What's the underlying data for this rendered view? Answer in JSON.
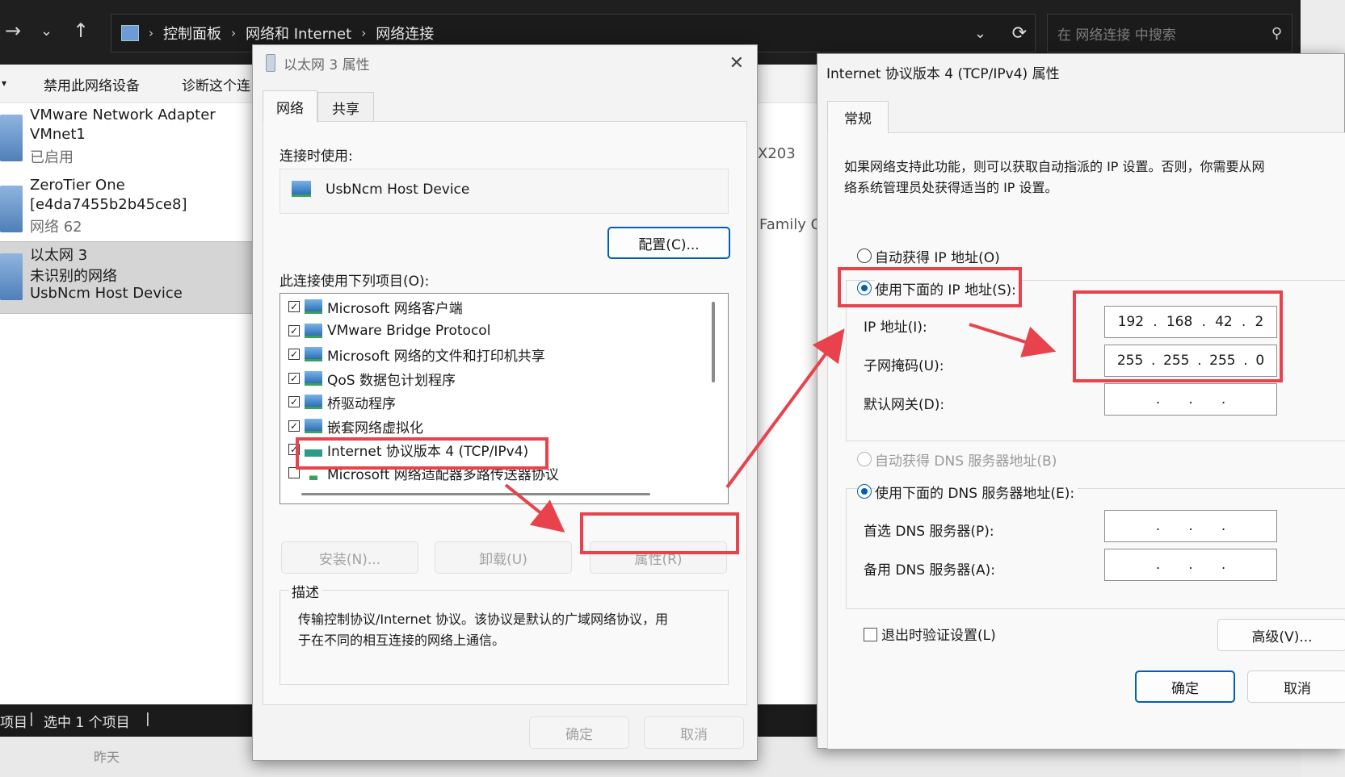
{
  "explorer": {
    "breadcrumb": [
      "控制面板",
      "网络和 Internet",
      "网络连接"
    ],
    "search_placeholder": "在 网络连接 中搜索",
    "toolbar": {
      "disable_label": "禁用此网络设备",
      "diagnose_label": "诊断这个连"
    },
    "adapters": [
      {
        "name": "VMware Network Adapter",
        "name2": "VMnet1",
        "status": "已启用"
      },
      {
        "name": "ZeroTier One",
        "name2": "[e4da7455b2b45ce8]",
        "status": "网络 62"
      },
      {
        "name": "以太网 3",
        "name2": "未识别的网络",
        "status": "UsbNcm Host Device"
      }
    ],
    "bg_text1": "X203",
    "bg_text2": "Family C",
    "status_items_count": "项目",
    "status_selected": "选中 1 个项目",
    "yesterday": "昨天"
  },
  "eth_dialog": {
    "title": "以太网 3 属性",
    "tabs": [
      "网络",
      "共享"
    ],
    "connect_using_label": "连接时使用:",
    "device_name": "UsbNcm Host Device",
    "configure_button": "配置(C)...",
    "items_label": "此连接使用下列项目(O):",
    "items": [
      {
        "label": "Microsoft 网络客户端",
        "checked": true
      },
      {
        "label": "VMware Bridge Protocol",
        "checked": true
      },
      {
        "label": "Microsoft 网络的文件和打印机共享",
        "checked": true
      },
      {
        "label": "QoS 数据包计划程序",
        "checked": true
      },
      {
        "label": "桥驱动程序",
        "checked": true
      },
      {
        "label": "嵌套网络虚拟化",
        "checked": true
      },
      {
        "label": "Internet 协议版本 4 (TCP/IPv4)",
        "checked": true
      },
      {
        "label": "Microsoft 网络适配器多路传送器协议",
        "checked": false
      }
    ],
    "install_button": "安装(N)...",
    "uninstall_button": "卸载(U)",
    "properties_button": "属性(R)",
    "description_label": "描述",
    "description_text_line1": "传输控制协议/Internet 协议。该协议是默认的广域网络协议，用",
    "description_text_line2": "于在不同的相互连接的网络上通信。",
    "ok_button": "确定",
    "cancel_button": "取消"
  },
  "ipv4_dialog": {
    "title": "Internet 协议版本 4 (TCP/IPv4) 属性",
    "tab": "常规",
    "intro_line1": "如果网络支持此功能，则可以获取自动指派的 IP 设置。否则，你需要从网",
    "intro_line2": "络系统管理员处获得适当的 IP 设置。",
    "auto_ip_label": "自动获得 IP 地址(O)",
    "manual_ip_label": "使用下面的 IP 地址(S):",
    "ip_label": "IP 地址(I):",
    "mask_label": "子网掩码(U):",
    "gateway_label": "默认网关(D):",
    "ip_address": [
      "192",
      "168",
      "42",
      "2"
    ],
    "subnet_mask": [
      "255",
      "255",
      "255",
      "0"
    ],
    "auto_dns_label": "自动获得 DNS 服务器地址(B)",
    "manual_dns_label": "使用下面的 DNS 服务器地址(E):",
    "preferred_dns_label": "首选 DNS 服务器(P):",
    "alternate_dns_label": "备用 DNS 服务器(A):",
    "validate_label": "退出时验证设置(L)",
    "advanced_button": "高级(V)...",
    "ok_button": "确定",
    "cancel_button": "取消",
    "ip_dot": "."
  },
  "colors": {
    "annotation_red": "#e8434c",
    "accent_blue": "#005fb8"
  }
}
